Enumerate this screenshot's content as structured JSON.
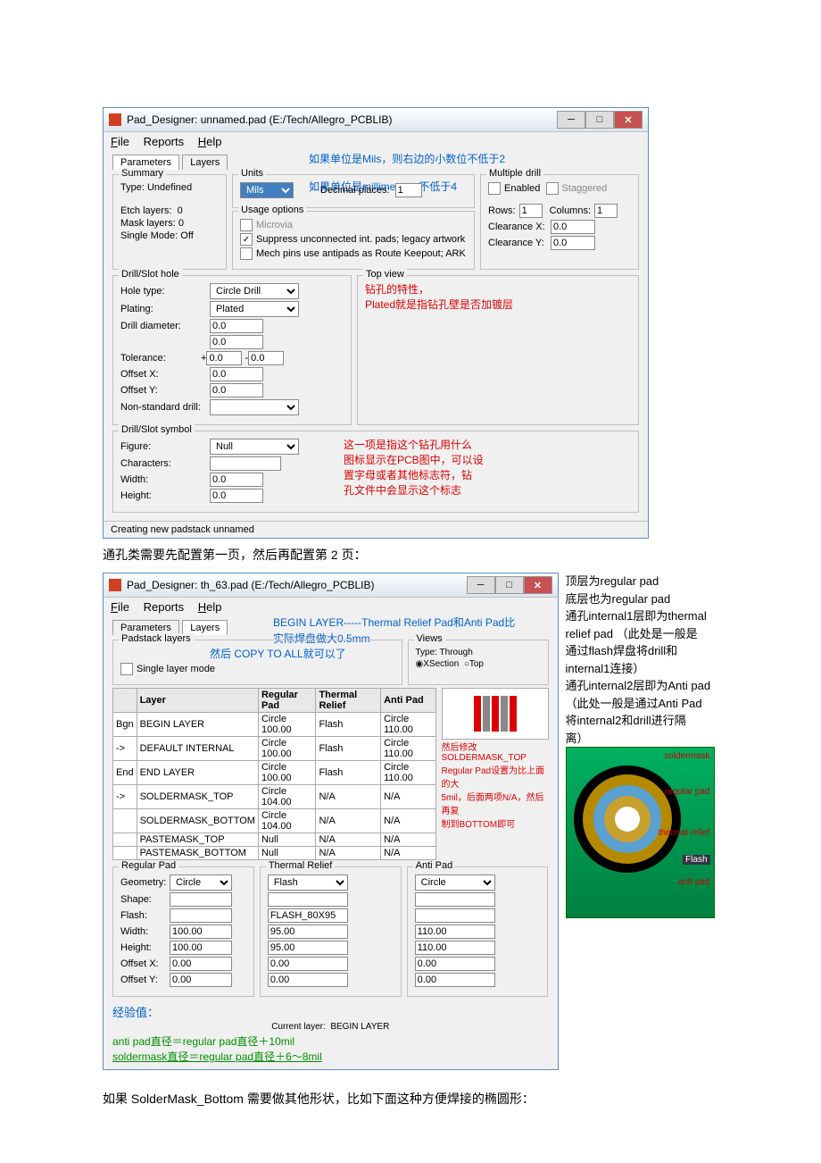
{
  "win1": {
    "title": "Pad_Designer: unnamed.pad (E:/Tech/Allegro_PCBLIB)",
    "menu": {
      "file": "File",
      "reports": "Reports",
      "help": "Help"
    },
    "note1": "如果单位是Mils，则右边的小数位不低于2",
    "note2": "如果单位是millimeter，不低于4",
    "tabs": {
      "param": "Parameters",
      "layers": "Layers"
    },
    "summary": {
      "legend": "Summary",
      "typeLabel": "Type:",
      "type": "Undefined",
      "etch": "Etch layers:",
      "etchv": "0",
      "mask": "Mask layers:",
      "maskv": "0",
      "single": "Single Mode:",
      "singlev": "Off"
    },
    "units": {
      "legend": "Units",
      "sel": "Mils",
      "dec": "Decimal places:",
      "decv": "1"
    },
    "usage": {
      "legend": "Usage options",
      "micro": "Microvia",
      "supp": "Suppress unconnected int. pads; legacy artwork",
      "mech": "Mech pins use antipads as Route Keepout; ARK"
    },
    "multi": {
      "legend": "Multiple drill",
      "en": "Enabled",
      "stag": "Staggered",
      "rows": "Rows:",
      "rowsv": "1",
      "cols": "Columns:",
      "colsv": "1",
      "cx": "Clearance X:",
      "cxv": "0.0",
      "cy": "Clearance Y:",
      "cyv": "0.0"
    },
    "drill": {
      "legend": "Drill/Slot hole",
      "hole": "Hole type:",
      "holev": "Circle Drill",
      "plat": "Plating:",
      "platv": "Plated",
      "dia": "Drill diameter:",
      "diav": "0.0",
      "diav2": "0.0",
      "tol": "Tolerance:",
      "tolp": "0.0",
      "tolm": "0.0",
      "offx": "Offset X:",
      "offxv": "0.0",
      "offy": "Offset Y:",
      "offyv": "0.0",
      "nsd": "Non-standard drill:"
    },
    "topview": {
      "legend": "Top view",
      "t1": "钻孔的特性，",
      "t2": "Plated就是指钻孔壁是否加镀层"
    },
    "sym": {
      "legend": "Drill/Slot symbol",
      "fig": "Figure:",
      "figv": "Null",
      "char": "Characters:",
      "wid": "Width:",
      "widv": "0.0",
      "hei": "Height:",
      "heiv": "0.0",
      "a1": "这一项是指这个钻孔用什么",
      "a2": "图标显示在PCB图中，可以设",
      "a3": "置字母或者其他标志符，钻",
      "a4": "孔文件中会显示这个标志"
    },
    "status": "Creating new padstack unnamed"
  },
  "inter1": "通孔类需要先配置第一页，然后再配置第 2 页：",
  "win2": {
    "title": "Pad_Designer: th_63.pad (E:/Tech/Allegro_PCBLIB)",
    "menu": {
      "file": "File",
      "reports": "Reports",
      "help": "Help"
    },
    "tabs": {
      "param": "Parameters",
      "layers": "Layers"
    },
    "n1": "BEGIN LAYER-----Thermal Relief Pad和Anti Pad比",
    "n2": "实际焊盘做大0.5mm",
    "n3": "然后 COPY TO ALL就可以了",
    "padlg": "Padstack layers",
    "slm": "Single layer mode",
    "views": {
      "legend": "Views",
      "type": "Type: Through",
      "xs": "XSection",
      "top": "Top"
    },
    "cols": {
      "layer": "Layer",
      "rp": "Regular Pad",
      "tr": "Thermal Relief",
      "ap": "Anti Pad"
    },
    "rows": [
      {
        "m": "Bgn",
        "l": "BEGIN LAYER",
        "r": "Circle 100.00",
        "t": "Flash",
        "a": "Circle 110.00"
      },
      {
        "m": "->",
        "l": "DEFAULT INTERNAL",
        "r": "Circle 100.00",
        "t": "Flash",
        "a": "Circle 110.00"
      },
      {
        "m": "End",
        "l": "END LAYER",
        "r": "Circle 100.00",
        "t": "Flash",
        "a": "Circle 110.00"
      },
      {
        "m": "->",
        "l": "SOLDERMASK_TOP",
        "r": "Circle 104.00",
        "t": "N/A",
        "a": "N/A"
      },
      {
        "m": "",
        "l": "SOLDERMASK_BOTTOM",
        "r": "Circle 104.00",
        "t": "N/A",
        "a": "N/A"
      },
      {
        "m": "",
        "l": "PASTEMASK_TOP",
        "r": "Null",
        "t": "N/A",
        "a": "N/A"
      },
      {
        "m": "",
        "l": "PASTEMASK_BOTTOM",
        "r": "Null",
        "t": "N/A",
        "a": "N/A"
      }
    ],
    "ann1": "然后修改SOLDERMASK_TOP",
    "ann2": "Regular Pad设置为比上面的大",
    "ann3": "5mil，后面两项N/A，然后再复",
    "ann4": "制到BOTTOM即可",
    "rp": {
      "legend": "Regular Pad",
      "geo": "Geometry:",
      "geov": "Circle",
      "shp": "Shape:",
      "flash": "Flash:",
      "wid": "Width:",
      "widv": "100.00",
      "hei": "Height:",
      "heiv": "100.00",
      "ox": "Offset X:",
      "oxv": "0.00",
      "oy": "Offset Y:",
      "oyv": "0.00"
    },
    "tr": {
      "legend": "Thermal Relief",
      "geov": "Flash",
      "flashv": "FLASH_80X95",
      "wid": "95.00",
      "hei": "95.00",
      "ox": "0.00",
      "oy": "0.00"
    },
    "ap": {
      "legend": "Anti Pad",
      "geov": "Circle",
      "wid": "110.00",
      "hei": "110.00",
      "ox": "0.00",
      "oy": "0.00"
    },
    "exp": {
      "t": "经验值：",
      "cl": "Current layer:",
      "clv": "BEGIN LAYER",
      "l1": "anti pad直径＝regular pad直径＋10mil",
      "l2": "soldermask直径＝regular pad直径＋6～8mil"
    }
  },
  "side": {
    "l1": "顶层为regular pad",
    "l2": "底层也为regular pad",
    "l3": "通孔internal1层即为thermal",
    "l4": "relief pad （此处是一般是",
    "l5": "通过flash焊盘将drill和",
    "l6": "internal1连接）",
    "l7": "通孔internal2层即为Anti pad",
    "l8": "（此处一般是通过Anti Pad",
    "l9": "将internal2和drill进行隔",
    "l10": "离）",
    "d": {
      "sm": "soldermask",
      "rp": "regular pad",
      "tr": "thermal relief",
      "fl": "Flash",
      "ap": "anti pad"
    }
  },
  "bottom": "如果 SolderMask_Bottom 需要做其他形状，比如下面这种方便焊接的椭圆形："
}
